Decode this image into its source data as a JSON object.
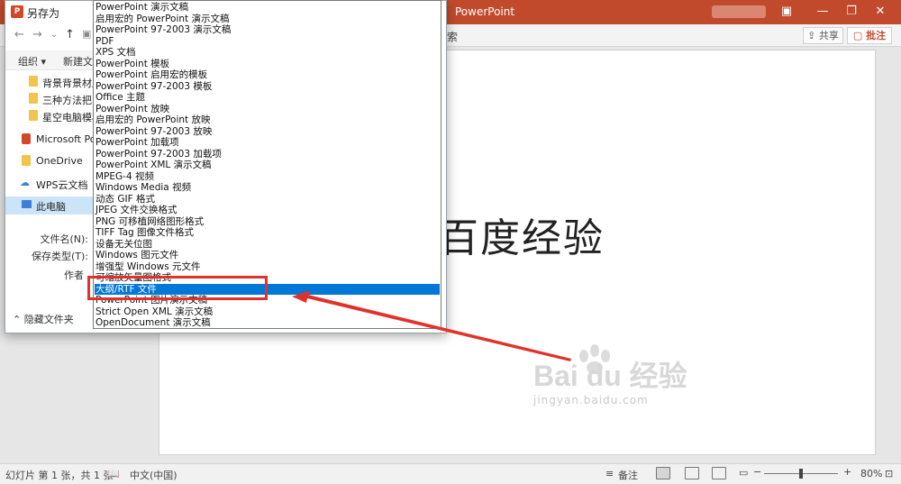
{
  "app": {
    "title": "PowerPoint",
    "ribbon_search": "索",
    "share_label": "共享",
    "comment_label": "批注",
    "icons": [
      "ribbon-display-icon",
      "minimize-icon",
      "restore-icon",
      "close-icon"
    ]
  },
  "slide": {
    "title": "百度经验",
    "watermark_brand": "Bai du 经验",
    "watermark_url": "jingyan.baidu.com"
  },
  "status_bar": {
    "slide_info": "幻灯片 第 1 张，共 1 张",
    "language": "中文(中国)",
    "notes_label": "备注",
    "zoom": "80%",
    "zoom_fraction": 0.5
  },
  "dialog": {
    "title": "另存为",
    "organize_label": "组织 ▾",
    "new_folder_label": "新建文",
    "tree": [
      {
        "label": "背景背景材质",
        "icon": "folder-icon"
      },
      {
        "label": "三种方法把pp",
        "icon": "folder-icon"
      },
      {
        "label": "星空电脑模板",
        "icon": "folder-icon"
      },
      {
        "label": "Microsoft Pow",
        "icon": "powerpoint-icon"
      },
      {
        "label": "OneDrive",
        "icon": "folder-icon"
      },
      {
        "label": "WPS云文档",
        "icon": "cloud-icon"
      },
      {
        "label": "此电脑",
        "icon": "computer-icon"
      }
    ],
    "filename_label": "文件名(N):",
    "filetype_label": "保存类型(T):",
    "author_label": "作者",
    "hide_folders_label": "隐藏文件夹"
  },
  "file_types": [
    "PowerPoint 演示文稿",
    "启用宏的 PowerPoint 演示文稿",
    "PowerPoint 97-2003 演示文稿",
    "PDF",
    "XPS 文档",
    "PowerPoint 模板",
    "PowerPoint 启用宏的模板",
    "PowerPoint 97-2003 模板",
    "Office 主题",
    "PowerPoint 放映",
    "启用宏的 PowerPoint 放映",
    "PowerPoint 97-2003 放映",
    "PowerPoint 加载项",
    "PowerPoint 97-2003 加载项",
    "PowerPoint XML 演示文稿",
    "MPEG-4 视频",
    "Windows Media 视频",
    "动态 GIF 格式",
    "JPEG 文件交换格式",
    "PNG 可移植网络图形格式",
    "TIFF Tag 图像文件格式",
    "设备无关位图",
    "Windows 图元文件",
    "增强型 Windows 元文件",
    "可缩放矢量图格式",
    "大纲/RTF 文件",
    "PowerPoint 图片演示文稿",
    "Strict Open XML 演示文稿",
    "OpenDocument 演示文稿"
  ],
  "selected_index": 25,
  "colors": {
    "title_bar": "#c24a2c",
    "selection": "#0078d7",
    "annotation": "#e0322b"
  }
}
